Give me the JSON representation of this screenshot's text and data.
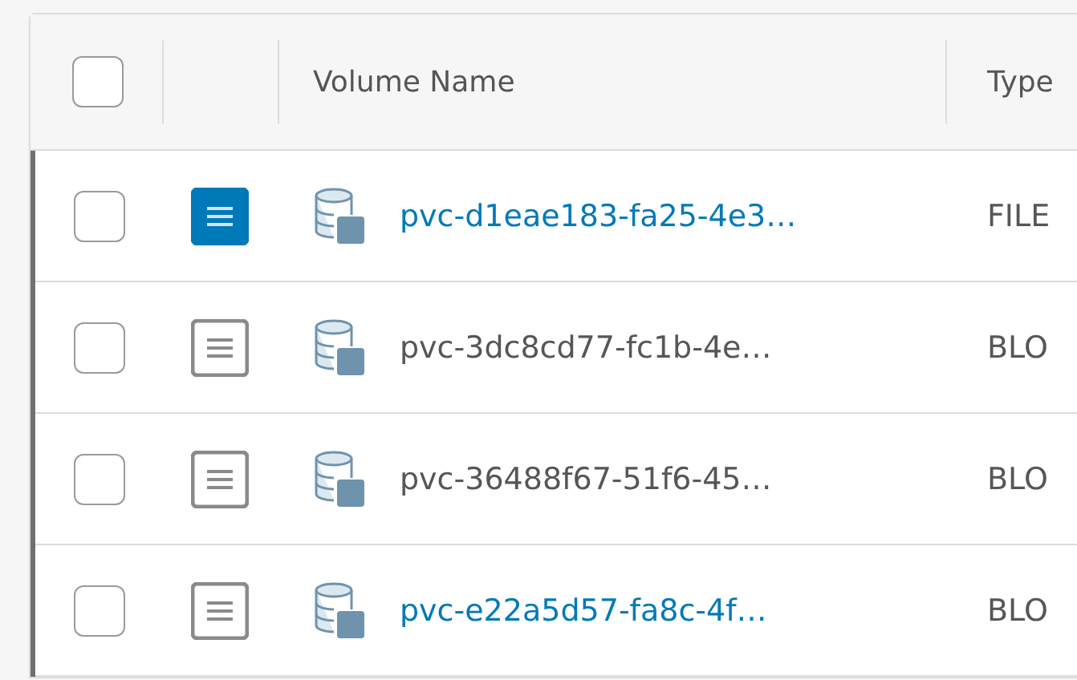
{
  "table": {
    "select_all": {
      "checked": false
    },
    "columns": [
      "Volume Name",
      "Type"
    ],
    "rows": [
      {
        "checked": false,
        "selected": true,
        "name": "pvc-d1eae183-fa25-4e3…",
        "linked": true,
        "type": "FILE"
      },
      {
        "checked": false,
        "selected": false,
        "name": "pvc-3dc8cd77-fc1b-4e…",
        "linked": false,
        "type": "BLO"
      },
      {
        "checked": false,
        "selected": false,
        "name": "pvc-36488f67-51f6-45…",
        "linked": false,
        "type": "BLO"
      },
      {
        "checked": false,
        "selected": false,
        "name": "pvc-e22a5d57-fa8c-4f…",
        "linked": true,
        "type": "BLO"
      }
    ]
  }
}
